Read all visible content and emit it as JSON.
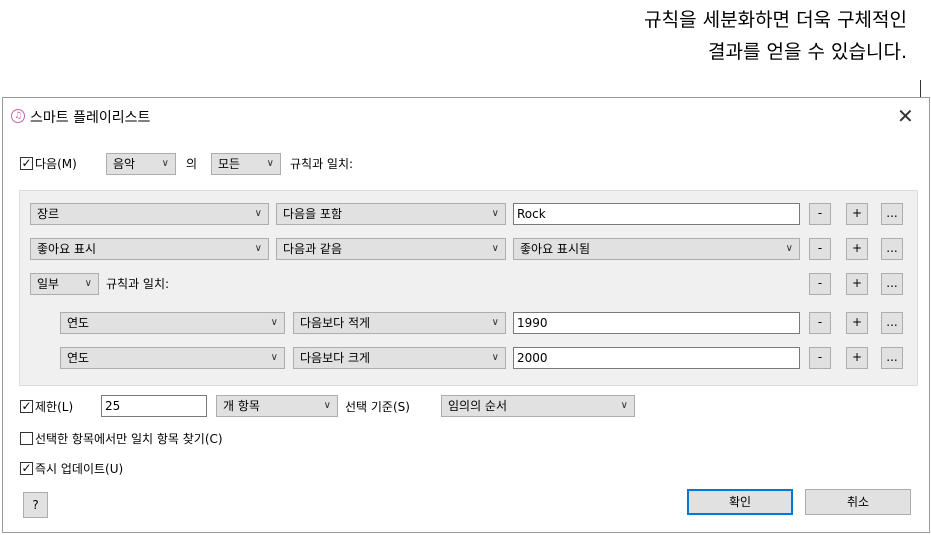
{
  "callout": {
    "line1": "규칙을 세분화하면 더욱 구체적인",
    "line2": "결과를 얻을 수 있습니다."
  },
  "window": {
    "title": "스마트 플레이리스트",
    "app_icon": "music-note-icon",
    "close_glyph": "✕"
  },
  "match": {
    "checked": true,
    "checkbox_label": "다음(M)",
    "media_value": "음악",
    "of_label": "의",
    "scope_value": "모든",
    "rule_suffix": "규칙과 일치:"
  },
  "rules": [
    {
      "field": "장르",
      "op": "다음을 포함",
      "value": "Rock",
      "value_type": "text"
    },
    {
      "field": "좋아요 표시",
      "op": "다음과 같음",
      "value": "좋아요 표시됨",
      "value_type": "select"
    }
  ],
  "nested": {
    "scope_value": "일부",
    "rule_suffix": "규칙과 일치:",
    "rules": [
      {
        "field": "연도",
        "op": "다음보다 적게",
        "value": "1990"
      },
      {
        "field": "연도",
        "op": "다음보다 크게",
        "value": "2000"
      }
    ]
  },
  "row_buttons": {
    "remove": "-",
    "add": "+",
    "more": "..."
  },
  "limit": {
    "checked": true,
    "label": "제한(L)",
    "value": "25",
    "unit_value": "개 항목",
    "selected_by_label": "선택 기준(S)",
    "selected_by_value": "임의의 순서"
  },
  "options": {
    "match_checked_only": {
      "checked": false,
      "label": "선택한 항목에서만 일치 항목 찾기(C)"
    },
    "live_updating": {
      "checked": true,
      "label": "즉시 업데이트(U)"
    }
  },
  "footer": {
    "help_label": "?",
    "ok_label": "확인",
    "cancel_label": "취소"
  },
  "colors": {
    "primary_border": "#0078d7",
    "control_bg": "#e1e1e1",
    "panel_bg": "#f0f0f0"
  }
}
